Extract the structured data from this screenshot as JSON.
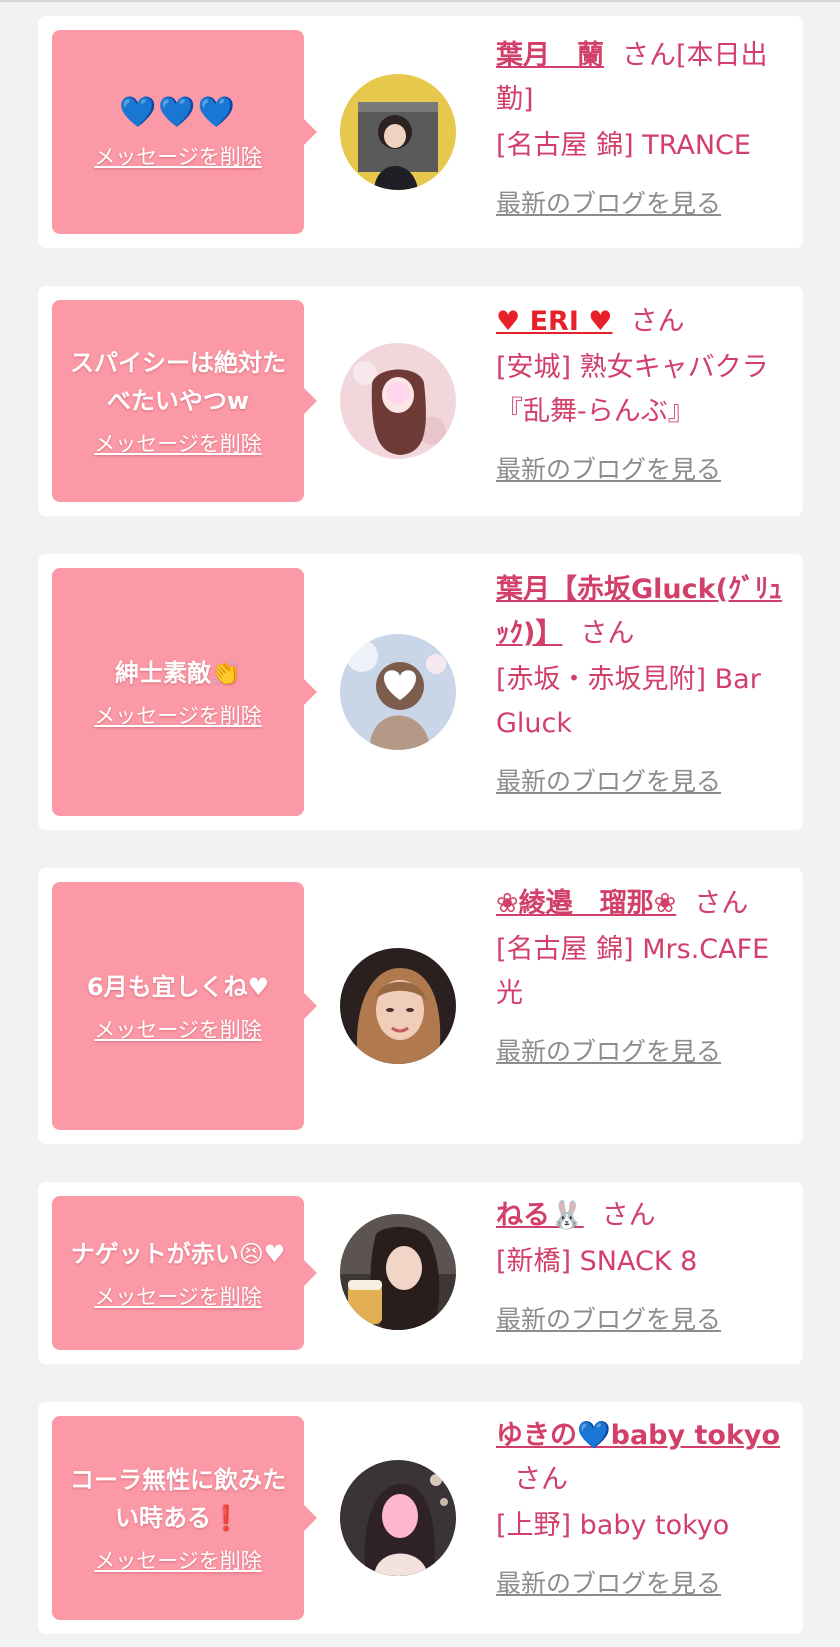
{
  "cards": [
    {
      "message": "💙💙💙",
      "delete_label": "メッセージを削除",
      "name": "葉月　蘭",
      "suffix": "さん[本日出勤]",
      "shop": "[名古屋 錦] TRANCE",
      "blog_label": "最新のブログを見る"
    },
    {
      "message": "スパイシーは絶対たべたいやつw",
      "delete_label": "メッセージを削除",
      "name": "♥ ERI ♥",
      "suffix": "さん",
      "shop": "[安城] 熟女キャバクラ『乱舞-らんぶ』",
      "blog_label": "最新のブログを見る"
    },
    {
      "message": "紳士素敵👏",
      "delete_label": "メッセージを削除",
      "name": "葉月【赤坂Gluck(ｸﾞﾘｭｯｸ)】",
      "suffix": "さん",
      "shop": "[赤坂・赤坂見附] Bar Gluck",
      "blog_label": "最新のブログを見る"
    },
    {
      "message": "6月も宜しくね♥",
      "delete_label": "メッセージを削除",
      "name": "❀綾邉　瑠那❀",
      "suffix": "さん",
      "shop": "[名古屋 錦] Mrs.CAFE 光",
      "blog_label": "最新のブログを見る"
    },
    {
      "message": "ナゲットが赤い😣♥",
      "delete_label": "メッセージを削除",
      "name": "ねる🐰",
      "suffix": "さん",
      "shop": "[新橋] SNACK 8",
      "blog_label": "最新のブログを見る"
    },
    {
      "message": "コーラ無性に飲みたい時ある❗",
      "delete_label": "メッセージを削除",
      "name": "ゆきの💙baby tokyo",
      "suffix": "さん",
      "shop": "[上野] baby tokyo",
      "blog_label": "最新のブログを見る"
    }
  ],
  "colors": {
    "background": "#f2f2f2",
    "card": "#ffffff",
    "bubble": "#fc99a6",
    "name_pink": "#d13f6a",
    "link_gray": "#8c8c8c"
  }
}
